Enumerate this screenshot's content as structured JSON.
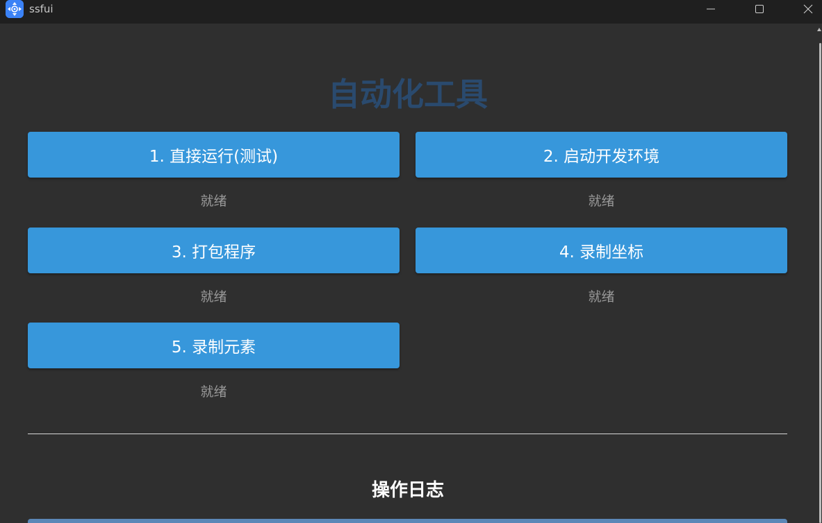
{
  "window": {
    "title": "ssfui"
  },
  "main": {
    "title": "自动化工具",
    "actions": [
      {
        "label": "1. 直接运行(测试)",
        "status": "就绪"
      },
      {
        "label": "2. 启动开发环境",
        "status": "就绪"
      },
      {
        "label": "3. 打包程序",
        "status": "就绪"
      },
      {
        "label": "4. 录制坐标",
        "status": "就绪"
      },
      {
        "label": "5. 录制元素",
        "status": "就绪"
      }
    ]
  },
  "log": {
    "heading": "操作日志"
  },
  "colors": {
    "button": "#3797db",
    "title": "#2a4a6e",
    "background": "#2f2f2f",
    "titlebar": "#1f1f1f"
  },
  "icons": {
    "app": "app-logo-icon",
    "minimize": "minimize-icon",
    "maximize": "maximize-icon",
    "close": "close-icon"
  }
}
